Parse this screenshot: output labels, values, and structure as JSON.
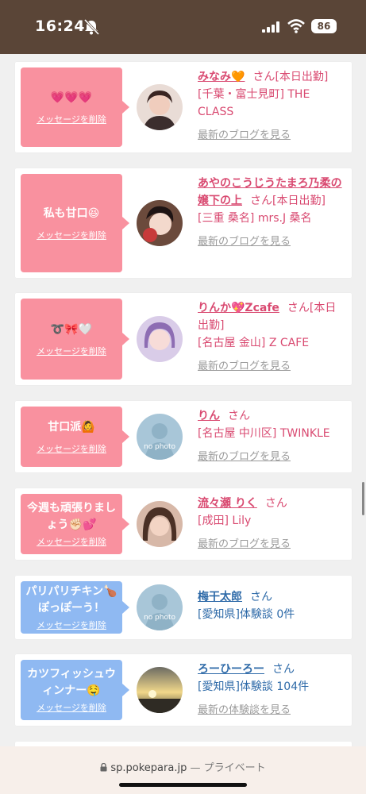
{
  "status": {
    "time": "16:24",
    "battery": "86"
  },
  "cards": [
    {
      "bubble_msg": "💗💗💗",
      "delete_label": "メッセージを削除",
      "name": "みなみ🧡",
      "san": "さん",
      "tag": "[本日出勤]",
      "shop": "[千葉・富士見町] THE CLASS",
      "blog": "最新のブログを見る"
    },
    {
      "bubble_msg": "私も甘口😆",
      "delete_label": "メッセージを削除",
      "name": "あやのこうじうたまろ乃柔の嬢下の上",
      "san": "さん",
      "tag": "[本日出勤]",
      "shop": "[三重 桑名] mrs.J 桑名",
      "blog": "最新のブログを見る"
    },
    {
      "bubble_msg": "➰🎀🤍",
      "delete_label": "メッセージを削除",
      "name": "りんか💖Zcafe",
      "san": "さん",
      "tag": "[本日出勤]",
      "shop": "[名古屋 金山] Z CAFE",
      "blog": "最新のブログを見る"
    },
    {
      "bubble_msg": "甘口派🙆",
      "delete_label": "メッセージを削除",
      "name": "りん",
      "san": "さん",
      "tag": "",
      "shop": "[名古屋 中川区] TWINKLE",
      "blog": "最新のブログを見る",
      "no_photo": "no photo"
    },
    {
      "bubble_msg": "今週も頑張りましょう✊🏻💕",
      "delete_label": "メッセージを削除",
      "name": "流々瀬 りく",
      "san": "さん",
      "tag": "",
      "shop": "[成田] Lily",
      "blog": "最新のブログを見る"
    },
    {
      "bubble_msg": "パリパリチキン🍗ぽっぽーう！",
      "delete_label": "メッセージを削除",
      "name": "梅干太郎",
      "san": "さん",
      "tag": "",
      "shop": "[愛知県]体験談 0件",
      "blog": "",
      "no_photo": "no photo"
    },
    {
      "bubble_msg": "カツフィッシュウィンナー🤤",
      "delete_label": "メッセージを削除",
      "name": "ろーひーろー",
      "san": "さん",
      "tag": "",
      "shop": "[愛知県]体験談 104件",
      "blog": "最新の体験談を見る"
    }
  ],
  "url_bar": {
    "domain": "sp.pokepara.jp",
    "mode": "— プライベート"
  },
  "colors": {
    "pink_bubble": "#f9919f",
    "blue_bubble": "#8fb9f2",
    "pink_text": "#d94a71",
    "blue_text": "#2e6aa8"
  }
}
